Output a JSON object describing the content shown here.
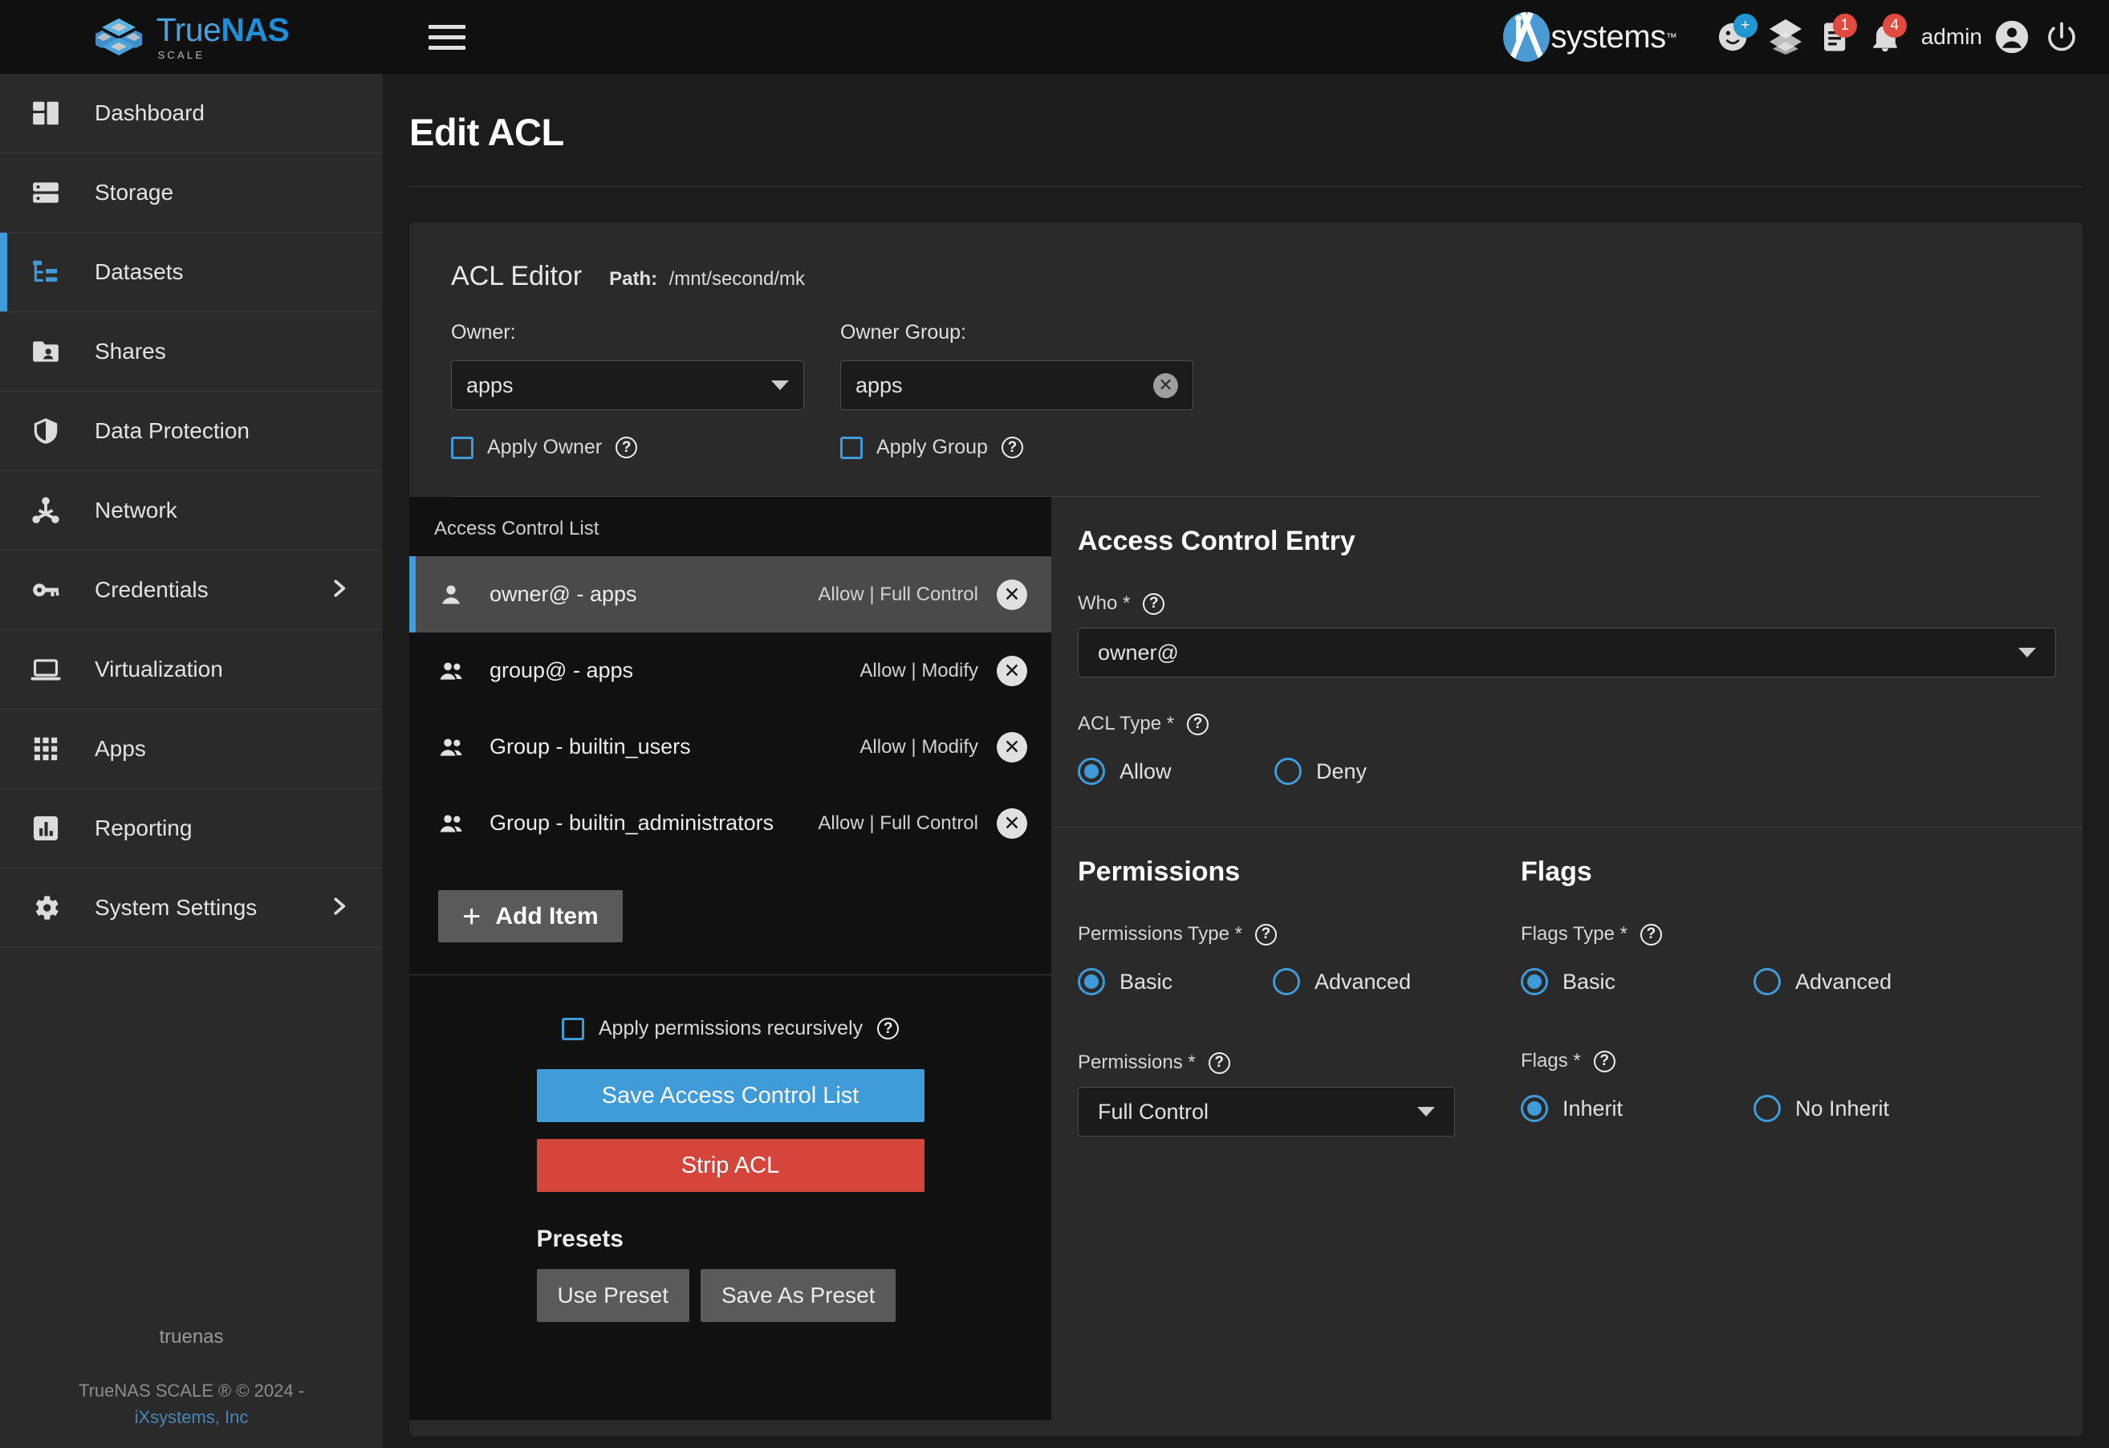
{
  "brand": {
    "name_part1": "True",
    "name_part2": "NAS",
    "edition": "SCALE",
    "vendor": "systems",
    "vendor_tm": "™"
  },
  "topbar": {
    "menu_icon": "hamburger-icon",
    "icons": [
      {
        "name": "add-user-icon",
        "badge": "+",
        "badge_kind": "blue"
      },
      {
        "name": "truecommand-icon",
        "badge": "",
        "badge_kind": ""
      },
      {
        "name": "jobs-icon",
        "badge": "1",
        "badge_kind": "red"
      },
      {
        "name": "notifications-bell-icon",
        "badge": "4",
        "badge_kind": "red"
      }
    ],
    "username": "admin",
    "account_icon": "account-circle-icon",
    "power_icon": "power-icon"
  },
  "sidebar": {
    "items": [
      {
        "label": "Dashboard",
        "icon": "dashboard-icon",
        "active": false,
        "expandable": false
      },
      {
        "label": "Storage",
        "icon": "storage-icon",
        "active": false,
        "expandable": false
      },
      {
        "label": "Datasets",
        "icon": "datasets-tree-icon",
        "active": true,
        "expandable": false
      },
      {
        "label": "Shares",
        "icon": "folder-shared-icon",
        "active": false,
        "expandable": false
      },
      {
        "label": "Data Protection",
        "icon": "shield-icon",
        "active": false,
        "expandable": false
      },
      {
        "label": "Network",
        "icon": "network-node-icon",
        "active": false,
        "expandable": false
      },
      {
        "label": "Credentials",
        "icon": "key-icon",
        "active": false,
        "expandable": true
      },
      {
        "label": "Virtualization",
        "icon": "laptop-icon",
        "active": false,
        "expandable": false
      },
      {
        "label": "Apps",
        "icon": "apps-grid-icon",
        "active": false,
        "expandable": false
      },
      {
        "label": "Reporting",
        "icon": "bar-chart-icon",
        "active": false,
        "expandable": false
      },
      {
        "label": "System Settings",
        "icon": "gear-icon",
        "active": false,
        "expandable": true
      }
    ],
    "footer": {
      "hostname": "truenas",
      "copyright": "TrueNAS SCALE ® © 2024 -",
      "company": "iXsystems, Inc"
    }
  },
  "page": {
    "title": "Edit ACL"
  },
  "acl_editor": {
    "title": "ACL Editor",
    "path_label": "Path:",
    "path_value": "/mnt/second/mk",
    "owner": {
      "label": "Owner:",
      "value": "apps",
      "checkbox_label": "Apply Owner",
      "checked": false
    },
    "owner_group": {
      "label": "Owner Group:",
      "value": "apps",
      "checkbox_label": "Apply Group",
      "checked": false,
      "clear_glyph": "✕"
    }
  },
  "acl_list": {
    "label": "Access Control List",
    "entries": [
      {
        "who": "owner@ - apps",
        "icon": "person-icon",
        "permission": "Allow | Full Control",
        "selected": true
      },
      {
        "who": "group@ - apps",
        "icon": "group-icon",
        "permission": "Allow | Modify",
        "selected": false
      },
      {
        "who": "Group - builtin_users",
        "icon": "group-icon",
        "permission": "Allow | Modify",
        "selected": false
      },
      {
        "who": "Group - builtin_administrators",
        "icon": "group-icon",
        "permission": "Allow | Full Control",
        "selected": false
      }
    ],
    "add_item_label": "Add Item",
    "add_item_glyph": "+",
    "delete_glyph": "✕"
  },
  "left_actions": {
    "recursive_label": "Apply permissions recursively",
    "recursive_checked": false,
    "save_label": "Save Access Control List",
    "strip_label": "Strip ACL",
    "presets_title": "Presets",
    "use_preset_label": "Use Preset",
    "save_as_preset_label": "Save As Preset"
  },
  "ace": {
    "title": "Access Control Entry",
    "who_label": "Who *",
    "who_value": "owner@",
    "acl_type_label": "ACL Type *",
    "acl_type_options": [
      {
        "label": "Allow",
        "selected": true
      },
      {
        "label": "Deny",
        "selected": false
      }
    ],
    "permissions_title": "Permissions",
    "permissions_type_label": "Permissions Type *",
    "permissions_type_options": [
      {
        "label": "Basic",
        "selected": true
      },
      {
        "label": "Advanced",
        "selected": false
      }
    ],
    "permissions_label": "Permissions *",
    "permissions_value": "Full Control",
    "flags_title": "Flags",
    "flags_type_label": "Flags Type *",
    "flags_type_options": [
      {
        "label": "Basic",
        "selected": true
      },
      {
        "label": "Advanced",
        "selected": false
      }
    ],
    "flags_label": "Flags *",
    "flags_options": [
      {
        "label": "Inherit",
        "selected": true
      },
      {
        "label": "No Inherit",
        "selected": false
      }
    ]
  },
  "colors": {
    "accent": "#3f9cd9",
    "danger": "#d4463c",
    "badge_red": "#e04a3f",
    "badge_blue": "#2196d3",
    "page_bg": "#1c1c1c",
    "card_bg": "#2a2a2a",
    "list_bg": "#111111"
  },
  "help_glyph": "?"
}
